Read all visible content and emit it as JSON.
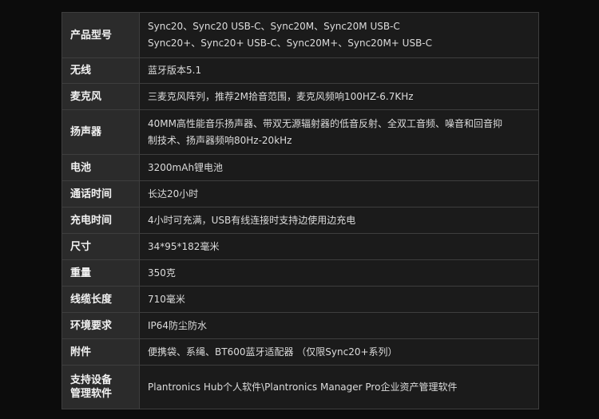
{
  "rows": [
    {
      "label": "产品型号",
      "value": "Sync20、Sync20 USB-C、Sync20M、Sync20M USB-C\nSync20+、Sync20+ USB-C、Sync20M+、Sync20M+ USB-C"
    },
    {
      "label": "无线",
      "value": "蓝牙版本5.1"
    },
    {
      "label": "麦克风",
      "value": "三麦克风阵列，推荐2M拾音范围，麦克风频响100HZ-6.7KHz"
    },
    {
      "label": "扬声器",
      "value": "40MM高性能音乐扬声器、带双无源辐射器的低音反射、全双工音频、噪音和回音抑\n制技术、扬声器频响80Hz-20kHz"
    },
    {
      "label": "电池",
      "value": "3200mAh锂电池"
    },
    {
      "label": "通话时间",
      "value": "长达20小时"
    },
    {
      "label": "充电时间",
      "value": "4小时可充满，USB有线连接时支持边使用边充电"
    },
    {
      "label": "尺寸",
      "value": "34*95*182毫米"
    },
    {
      "label": "重量",
      "value": "350克"
    },
    {
      "label": "线缆长度",
      "value": "710毫米"
    },
    {
      "label": "环境要求",
      "value": "IP64防尘防水"
    },
    {
      "label": "附件",
      "value": "便携袋、系绳、BT600蓝牙适配器 （仅限Sync20+系列）"
    },
    {
      "label": "支持设备\n管理软件",
      "value": "Plantronics Hub个人软件\\Plantronics Manager Pro企业资产管理软件"
    }
  ]
}
